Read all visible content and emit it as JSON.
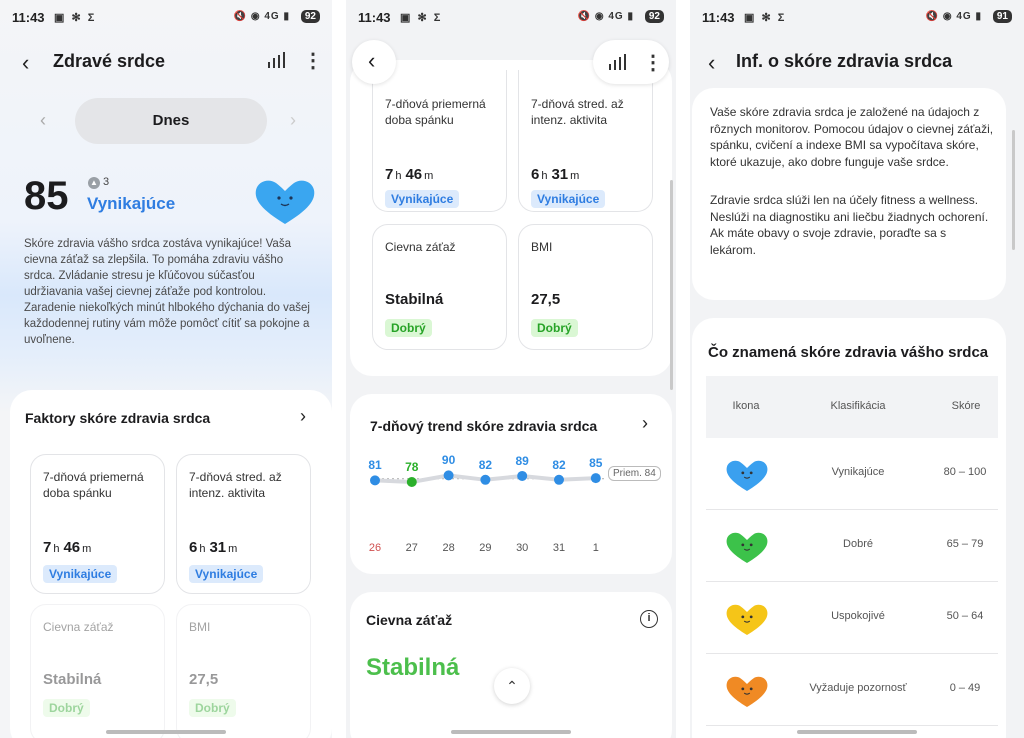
{
  "status": {
    "time": "11:43",
    "network": "4G",
    "battery_left": "92",
    "battery_mid": "92",
    "battery_right": "91"
  },
  "screen1": {
    "title": "Zdravé srdce",
    "date_label": "Dnes",
    "score": "85",
    "delta": "3",
    "rating": "Vynikajúce",
    "description": "Skóre zdravia vášho srdca zostáva vynikajúce! Vaša cievna záťaž sa zlepšila. To pomáha zdraviu vášho srdca. Zvládanie stresu je kľúčovou súčasťou udržiavania vašej cievnej záťaže pod kontrolou. Zaradenie niekoľkých minút hlbokého dýchania do vašej každodennej rutiny vám môže pomôcť cítiť sa pokojne a uvoľnene.",
    "factors_title": "Faktory skóre zdravia srdca",
    "tiles": [
      {
        "label": "7-dňová priemerná doba spánku",
        "h": "7",
        "h_unit": "h",
        "m": "46",
        "m_unit": "m",
        "badge": "Vynikajúce"
      },
      {
        "label": "7-dňová stred. až intenz. aktivita",
        "h": "6",
        "h_unit": "h",
        "m": "31",
        "m_unit": "m",
        "badge": "Vynikajúce"
      },
      {
        "label": "Cievna záťaž",
        "value": "Stabilná",
        "badge": "Dobrý"
      },
      {
        "label": "BMI",
        "value": "27,5",
        "badge": "Dobrý"
      }
    ]
  },
  "screen2": {
    "trend_title": "7-dňový trend skóre zdravia srdca",
    "average_label": "Priem. 84",
    "vascular_title": "Cievna záťaž",
    "vascular_value": "Stabilná",
    "trend": {
      "days": [
        "26",
        "27",
        "28",
        "29",
        "30",
        "31",
        "1"
      ],
      "values": [
        81,
        78,
        90,
        82,
        89,
        82,
        85
      ],
      "colors": [
        "#2f8de4",
        "#2bb02b",
        "#2f8de4",
        "#2f8de4",
        "#2f8de4",
        "#2f8de4",
        "#2f8de4"
      ],
      "average": 84
    }
  },
  "screen3": {
    "title": "Inf. o skóre zdravia srdca",
    "para1": "Vaše skóre zdravia srdca je založené na údajoch z rôznych monitorov. Pomocou údajov o cievnej záťaži, spánku, cvičení a indexe BMI sa vypočítava skóre, ktoré ukazuje, ako dobre funguje vaše srdce.",
    "para2": "Zdravie srdca slúži len na účely fitness a wellness. Neslúži na diagnostiku ani liečbu žiadnych ochorení. Ak máte obavy o svoje zdravie, poraďte sa s lekárom.",
    "meaning_title": "Čo znamená skóre zdravia vášho srdca",
    "headers": {
      "icon": "Ikona",
      "class": "Klasifikácia",
      "score": "Skóre"
    },
    "rows": [
      {
        "label": "Vynikajúce",
        "range": "80 – 100",
        "color": "#3aa0ef"
      },
      {
        "label": "Dobré",
        "range": "65 – 79",
        "color": "#3cc24a"
      },
      {
        "label": "Uspokojivé",
        "range": "50 – 64",
        "color": "#f5c518"
      },
      {
        "label": "Vyžaduje pozornosť",
        "range": "0 – 49",
        "color": "#f08a24"
      }
    ]
  }
}
